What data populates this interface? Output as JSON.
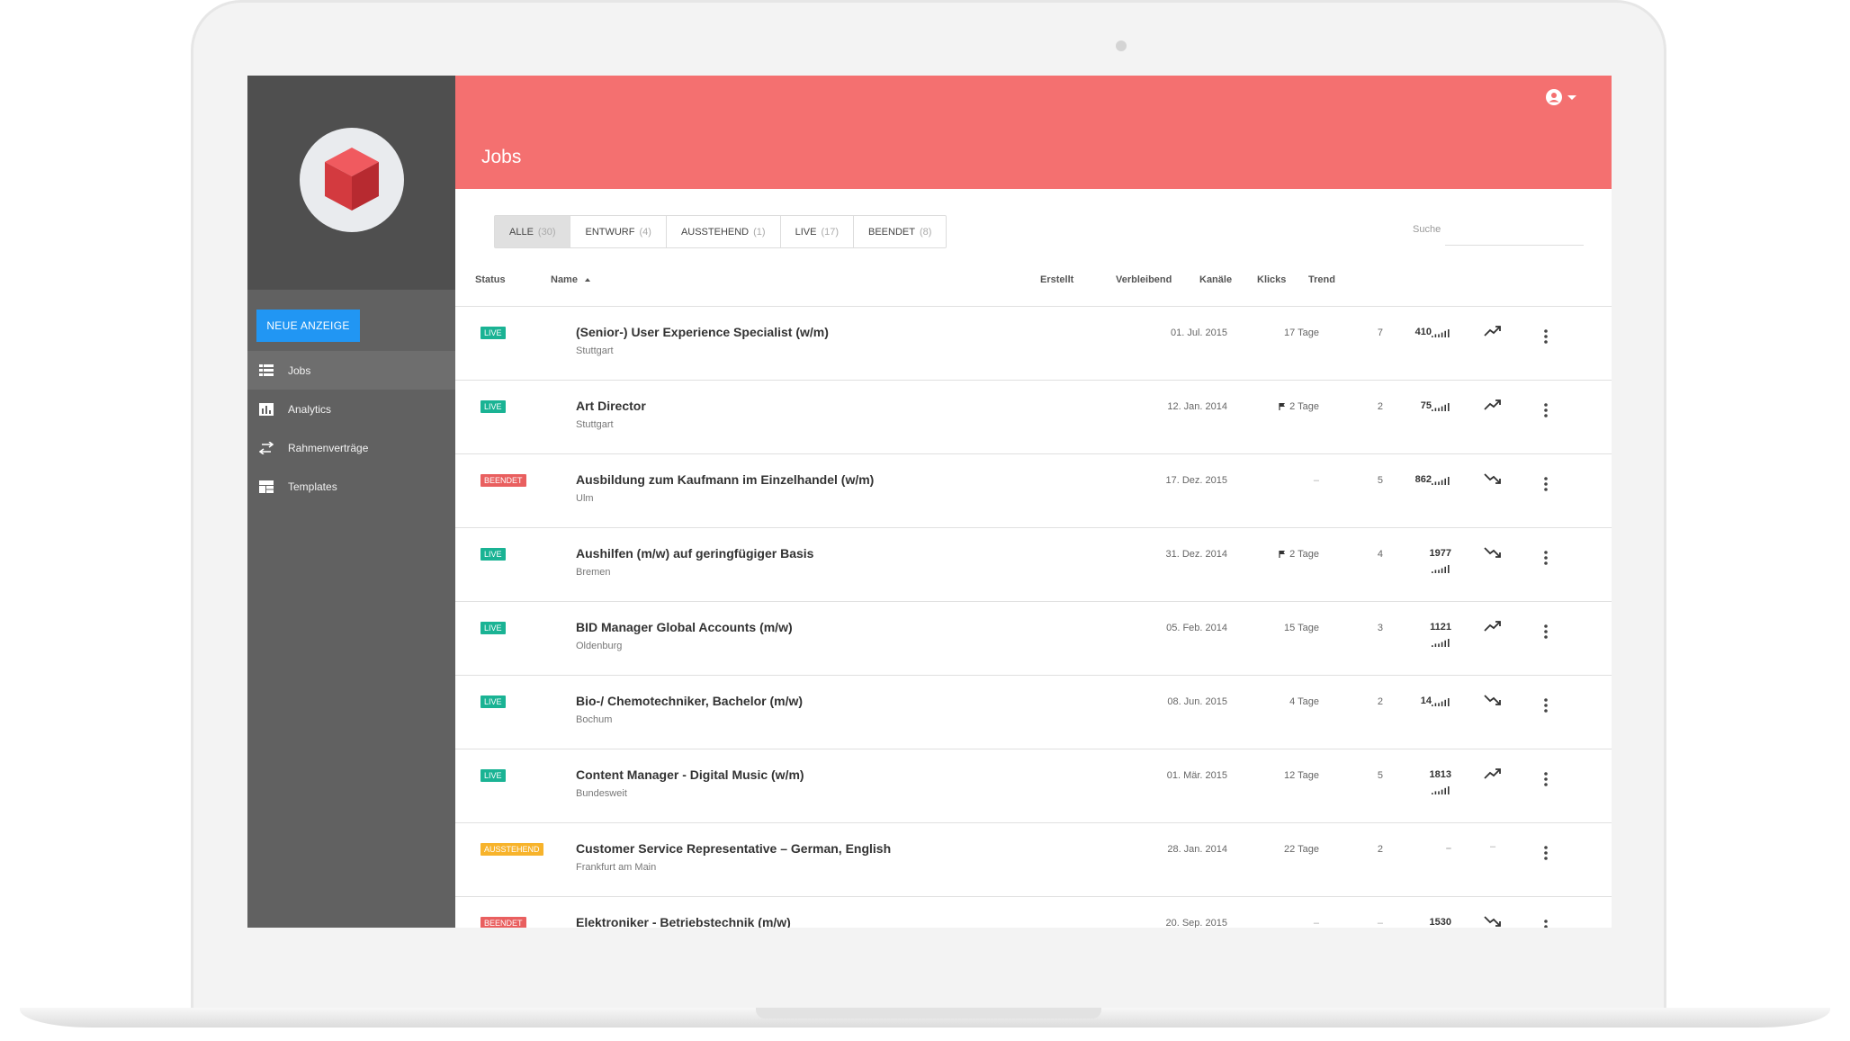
{
  "app": {
    "header_title": "Jobs",
    "new_button_label": "NEUE ANZEIGE",
    "accent": "#f47070",
    "sidebar_color": "#616161"
  },
  "sidebar": {
    "items": [
      {
        "label": "Jobs",
        "icon": "list-icon",
        "active": true
      },
      {
        "label": "Analytics",
        "icon": "bar-chart-icon",
        "active": false
      },
      {
        "label": "Rahmenverträge",
        "icon": "swap-arrows-icon",
        "active": false
      },
      {
        "label": "Templates",
        "icon": "grid-icon",
        "active": false
      }
    ]
  },
  "tabs": [
    {
      "label": "ALLE",
      "count": "(30)",
      "active": true
    },
    {
      "label": "ENTWURF",
      "count": "(4)",
      "active": false
    },
    {
      "label": "AUSSTEHEND",
      "count": "(1)",
      "active": false
    },
    {
      "label": "LIVE",
      "count": "(17)",
      "active": false
    },
    {
      "label": "BEENDET",
      "count": "(8)",
      "active": false
    }
  ],
  "search": {
    "label": "Suche",
    "value": ""
  },
  "columns": {
    "status": "Status",
    "name": "Name",
    "created": "Erstellt",
    "remaining": "Verbleibend",
    "channels": "Kanäle",
    "clicks": "Klicks",
    "trend": "Trend"
  },
  "status_colors": {
    "LIVE": "#1ab394",
    "BEENDET": "#e95f5f",
    "AUSSTEHEND": "#f7b32b"
  },
  "jobs": [
    {
      "status": "LIVE",
      "title": "(Senior-) User Experience Specialist (w/m)",
      "location": "Stuttgart",
      "created": "01. Jul. 2015",
      "remaining": "17 Tage",
      "flag": false,
      "channels": "7",
      "clicks": "410",
      "spark_inline": true,
      "trend": "up"
    },
    {
      "status": "LIVE",
      "title": "Art Director",
      "location": "Stuttgart",
      "created": "12. Jan. 2014",
      "remaining": "2 Tage",
      "flag": true,
      "channels": "2",
      "clicks": "75",
      "spark_inline": true,
      "trend": "up"
    },
    {
      "status": "BEENDET",
      "title": "Ausbildung zum Kaufmann im Einzelhandel (w/m)",
      "location": "Ulm",
      "created": "17. Dez. 2015",
      "remaining": "–",
      "flag": false,
      "channels": "5",
      "clicks": "862",
      "spark_inline": true,
      "trend": "down"
    },
    {
      "status": "LIVE",
      "title": "Aushilfen (m/w) auf geringfügiger Basis",
      "location": "Bremen",
      "created": "31. Dez. 2014",
      "remaining": "2 Tage",
      "flag": true,
      "channels": "4",
      "clicks": "1977",
      "spark_inline": false,
      "trend": "down"
    },
    {
      "status": "LIVE",
      "title": "BID Manager Global Accounts (m/w)",
      "location": "Oldenburg",
      "created": "05. Feb. 2014",
      "remaining": "15 Tage",
      "flag": false,
      "channels": "3",
      "clicks": "1121",
      "spark_inline": false,
      "trend": "up"
    },
    {
      "status": "LIVE",
      "title": "Bio-/ Chemotechniker, Bachelor (m/w)",
      "location": "Bochum",
      "created": "08. Jun. 2015",
      "remaining": "4 Tage",
      "flag": false,
      "channels": "2",
      "clicks": "14",
      "spark_inline": true,
      "trend": "down"
    },
    {
      "status": "LIVE",
      "title": "Content Manager - Digital Music (w/m)",
      "location": "Bundesweit",
      "created": "01. Mär. 2015",
      "remaining": "12 Tage",
      "flag": false,
      "channels": "5",
      "clicks": "1813",
      "spark_inline": false,
      "trend": "up"
    },
    {
      "status": "AUSSTEHEND",
      "title": "Customer Service Representative – German, English",
      "location": "Frankfurt am Main",
      "created": "28. Jan. 2014",
      "remaining": "22 Tage",
      "flag": false,
      "channels": "2",
      "clicks": "–",
      "spark_inline": null,
      "trend": "none"
    },
    {
      "status": "BEENDET",
      "title": "Elektroniker - Betriebstechnik (m/w)",
      "location": "",
      "created": "20. Sep. 2015",
      "remaining": "–",
      "flag": false,
      "channels": "–",
      "clicks": "1530",
      "spark_inline": null,
      "trend": "down"
    }
  ]
}
